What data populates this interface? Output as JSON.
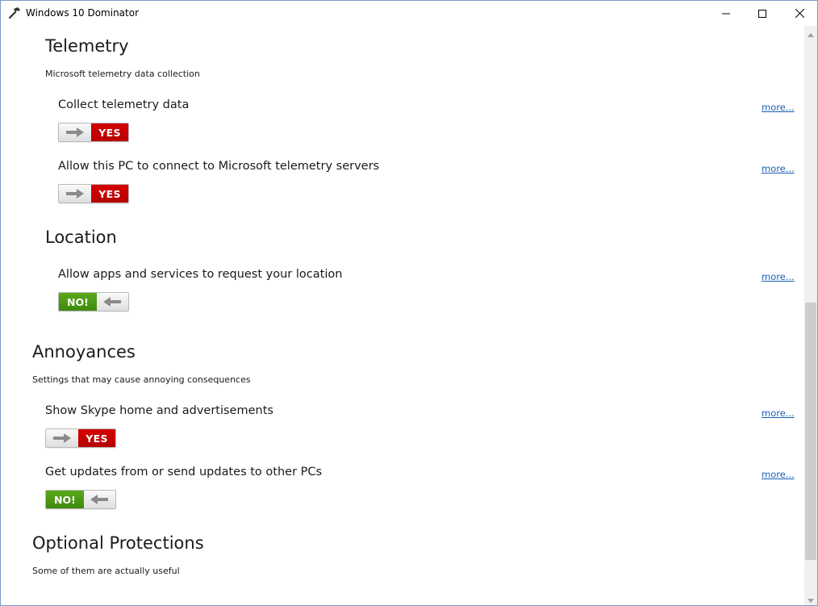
{
  "window": {
    "title": "Windows 10 Dominator",
    "icons": {
      "app": "hammer-icon",
      "minimize": "minimize-icon",
      "maximize": "maximize-icon",
      "close": "close-icon"
    }
  },
  "sections": [
    {
      "heading": "Telemetry",
      "description": "Microsoft telemetry data collection",
      "settings": [
        {
          "label": "Collect telemetry data",
          "state": "YES",
          "more": "more..."
        },
        {
          "label": "Allow this PC to connect to Microsoft telemetry servers",
          "state": "YES",
          "more": "more..."
        }
      ]
    },
    {
      "heading": "Location",
      "settings": [
        {
          "label": "Allow apps and services to request your location",
          "state": "NO!",
          "more": "more..."
        }
      ]
    },
    {
      "heading": "Annoyances",
      "description": "Settings that may cause annoying consequences",
      "settings": [
        {
          "label": "Show Skype home and advertisements",
          "state": "YES",
          "more": "more..."
        },
        {
          "label": "Get updates from or send updates to other PCs",
          "state": "NO!",
          "more": "more..."
        }
      ]
    },
    {
      "heading": "Optional Protections",
      "description": "Some of them are actually useful"
    }
  ],
  "colors": {
    "yes": "#c00000",
    "no": "#4a9a14",
    "link": "#1a5fb4"
  },
  "scrollbar": {
    "position_fraction": 0.62
  }
}
